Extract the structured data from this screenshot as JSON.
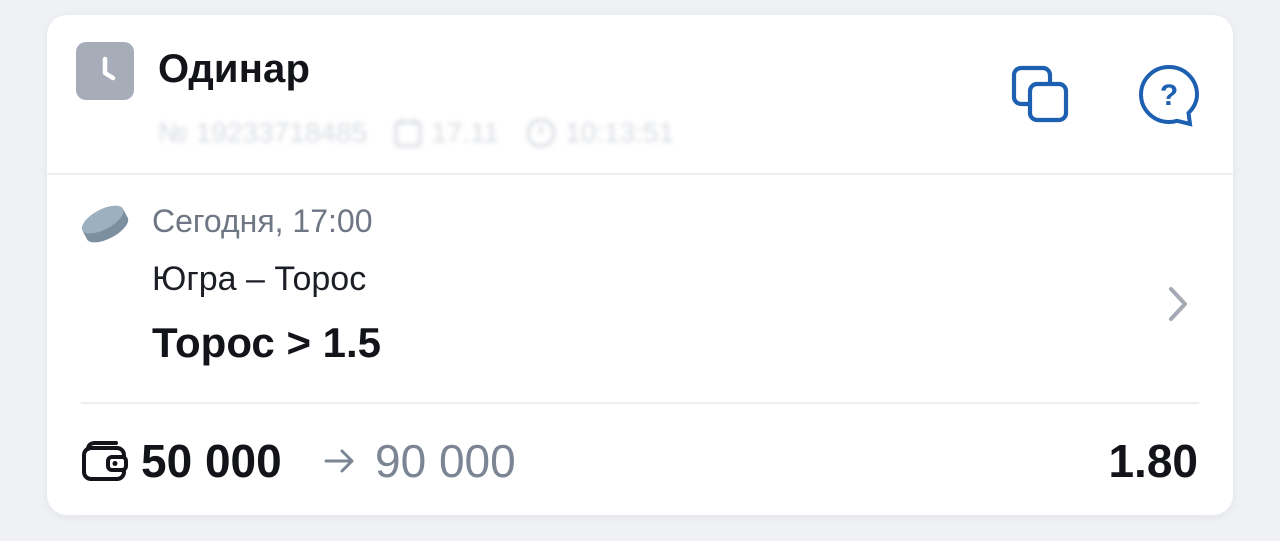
{
  "header": {
    "bet_type": "Одинар",
    "status_icon": "clock-icon",
    "meta": {
      "bet_number": "№ 19233718485",
      "date": "17.11",
      "time": "10:13:51"
    },
    "copy_icon": "copy-icon",
    "help_icon": "question-chat-icon"
  },
  "event": {
    "sport_icon": "hockey-puck-icon",
    "time": "Сегодня, 17:00",
    "teams": "Югра – Торос",
    "selection": "Торос > 1.5"
  },
  "footer": {
    "wallet_icon": "wallet-icon",
    "stake": "50 000",
    "arrow": "→",
    "payout": "90 000",
    "odds": "1.80"
  },
  "colors": {
    "accent": "#1d5fb0",
    "status_gray": "#a7adb8",
    "puck": "#7b8fa1",
    "muted_text": "#7c8594"
  }
}
